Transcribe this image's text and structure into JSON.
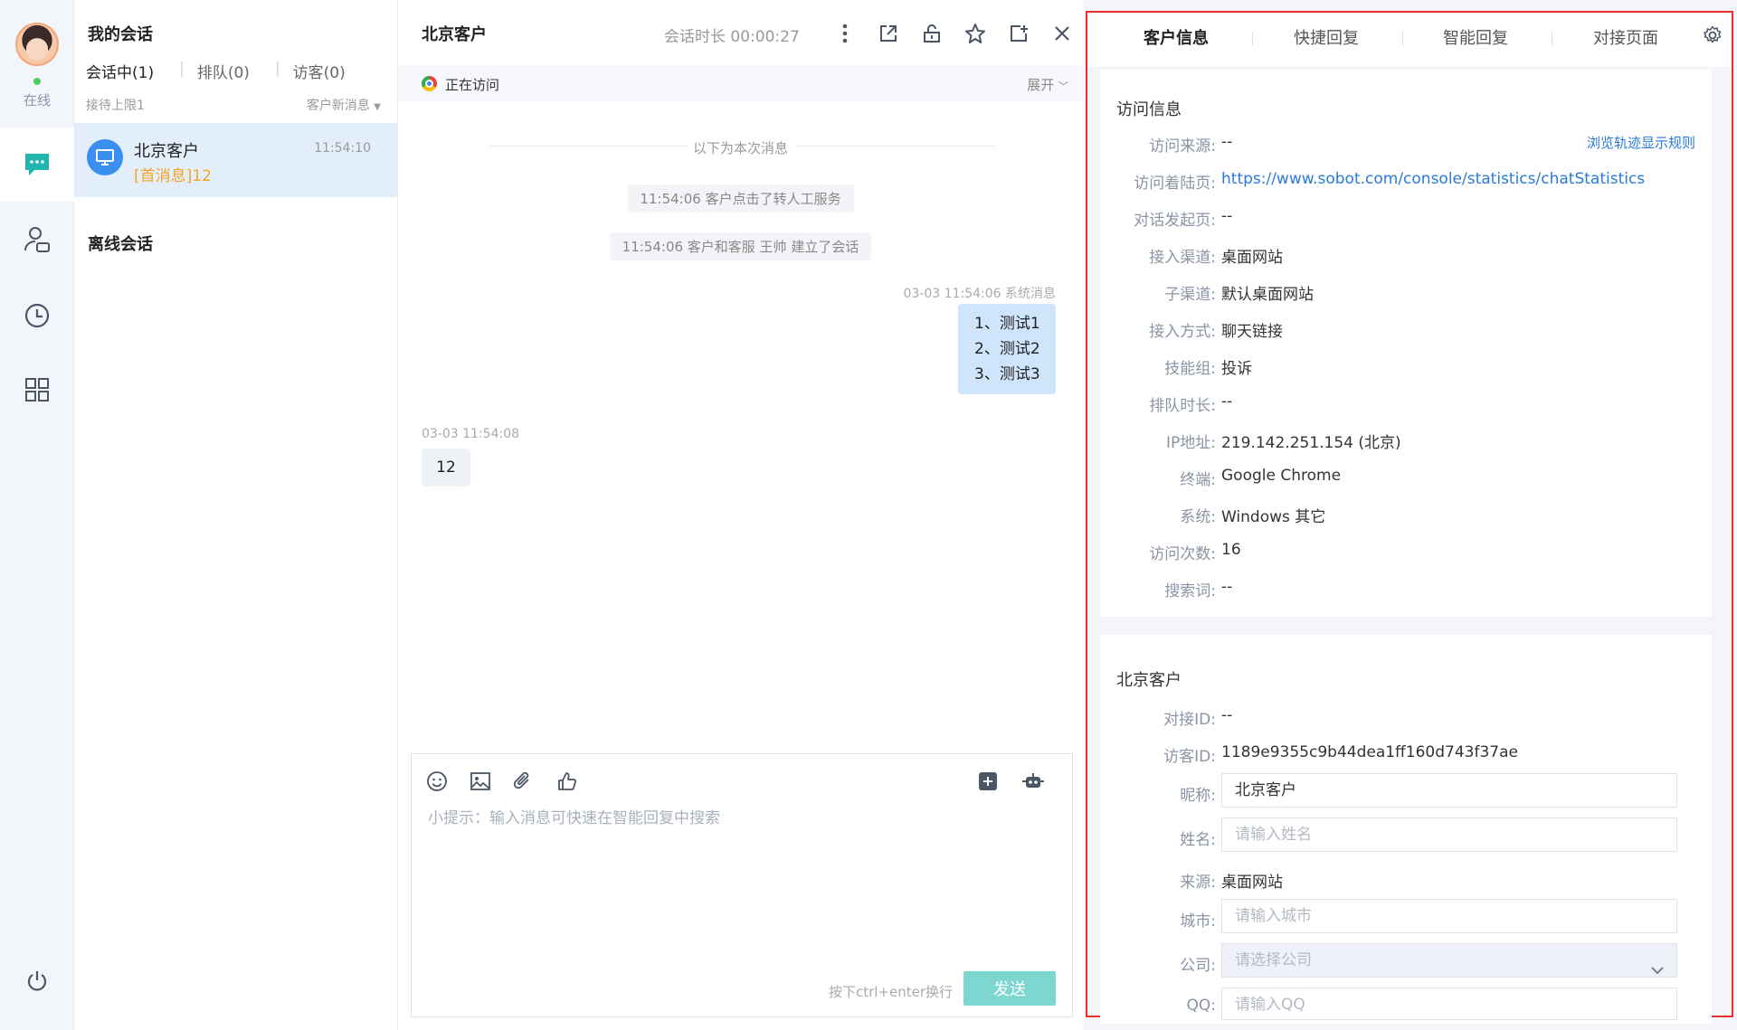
{
  "rail": {
    "status": "在线",
    "icons": [
      "chat-icon",
      "customer-icon",
      "history-icon",
      "apps-icon",
      "power-icon"
    ]
  },
  "convlist": {
    "title": "我的会话",
    "tabs": [
      "会话中(1)",
      "排队(0)",
      "访客(0)"
    ],
    "limit": "接待上限1",
    "sort": "客户新消息",
    "item": {
      "name": "北京客户",
      "time": "11:54:10",
      "message": "[首消息]12"
    },
    "offline_title": "离线会话"
  },
  "chat": {
    "title": "北京客户",
    "duration": "会话时长 00:00:27",
    "visit_status": "正在访问",
    "expand": "展开",
    "divider": "以下为本次消息",
    "system": [
      "11:54:06 客户点击了转人工服务",
      "11:54:06 客户和客服 王帅 建立了会话"
    ],
    "agent_meta": "03-03 11:54:06   系统消息",
    "agent_lines": [
      "1、测试1",
      "2、测试2",
      "3、测试3"
    ],
    "customer_meta": "03-03 11:54:08",
    "customer_msg": "12",
    "placeholder": "小提示：输入消息可快速在智能回复中搜索",
    "hint": "按下ctrl+enter换行",
    "send": "发送"
  },
  "info": {
    "tabs": [
      "客户信息",
      "快捷回复",
      "智能回复",
      "对接页面"
    ],
    "visit": {
      "title": "访问信息",
      "rule_link": "浏览轨迹显示规则",
      "rows": [
        {
          "label": "访问来源:",
          "value": "--"
        },
        {
          "label": "访问着陆页:",
          "value": "https://www.sobot.com/console/statistics/chatStatistics"
        },
        {
          "label": "对话发起页:",
          "value": "--"
        },
        {
          "label": "接入渠道:",
          "value": "桌面网站"
        },
        {
          "label": "子渠道:",
          "value": "默认桌面网站"
        },
        {
          "label": "接入方式:",
          "value": "聊天链接"
        },
        {
          "label": "技能组:",
          "value": "投诉"
        },
        {
          "label": "排队时长:",
          "value": "--"
        },
        {
          "label": "IP地址:",
          "value": "219.142.251.154 (北京)"
        },
        {
          "label": "终端:",
          "value": "Google Chrome"
        },
        {
          "label": "系统:",
          "value": "Windows 其它"
        },
        {
          "label": "访问次数:",
          "value": "16"
        },
        {
          "label": "搜索词:",
          "value": "--"
        }
      ]
    },
    "customer": {
      "title": "北京客户",
      "dock_id_label": "对接ID:",
      "dock_id": "--",
      "visitor_id_label": "访客ID:",
      "visitor_id": "1189e9355c9b44dea1ff160d743f37ae",
      "nickname_label": "昵称:",
      "nickname": "北京客户",
      "name_label": "姓名:",
      "name_placeholder": "请输入姓名",
      "source_label": "来源:",
      "source": "桌面网站",
      "city_label": "城市:",
      "city_placeholder": "请输入城市",
      "company_label": "公司:",
      "company_placeholder": "请选择公司",
      "qq_label": "QQ:",
      "qq_placeholder": "请输入QQ"
    }
  },
  "colors": {
    "accent": "#2a7ad8",
    "send": "#7ed6d0",
    "highlight_border": "#e8312f",
    "unread": "#f5a524"
  }
}
